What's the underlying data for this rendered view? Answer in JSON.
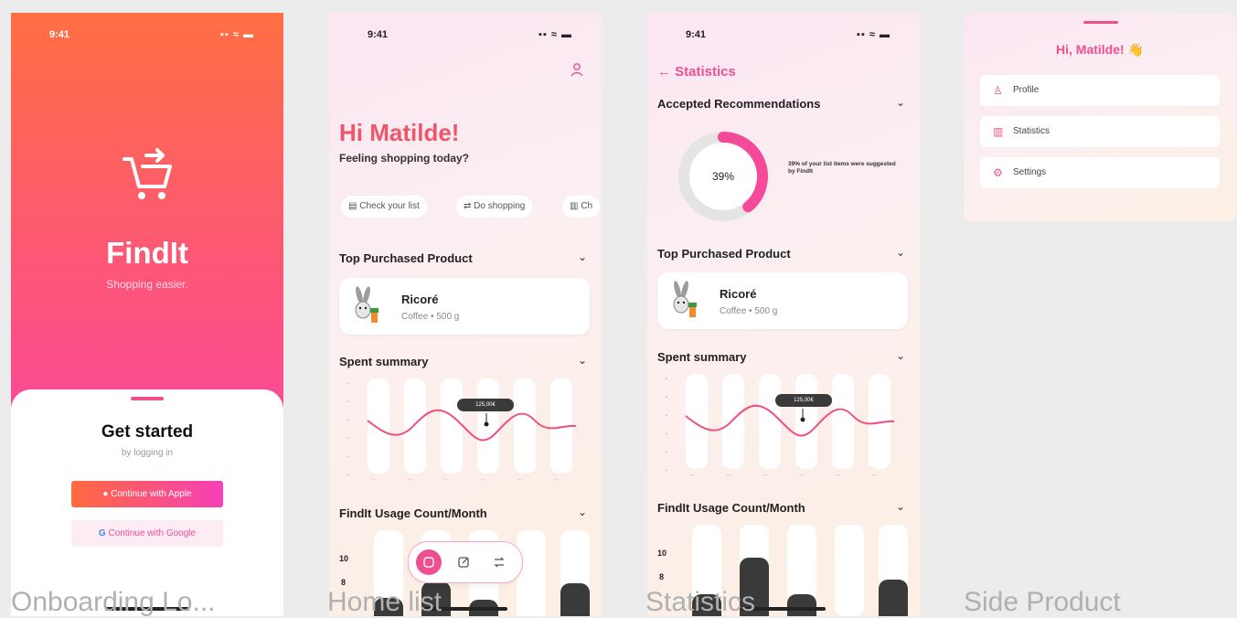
{
  "screens": {
    "onboarding": {
      "status_time": "9:41",
      "status_icons": "▪▪ ≈ ▬",
      "app_name": "FindIt",
      "tagline": "Shopping easier.",
      "sheet_title": "Get started",
      "sheet_subtitle": "by logging in",
      "apple_button": "Continue with Apple",
      "google_button": "Continue with Google",
      "google_g": "G",
      "caption": "Onboarding Lo..."
    },
    "home": {
      "status_time": "9:41",
      "status_icons": "▪▪ ≈ ▬",
      "greeting": "Hi Matilde!",
      "subgreeting": "Feeling shopping today?",
      "chips": [
        "Check your list",
        "Do shopping",
        "Ch"
      ],
      "top_section": "Top Purchased Product",
      "product_name": "Ricoré",
      "product_sub": "Coffee • 500 g",
      "spent_section": "Spent summary",
      "spent_tooltip": "125,00€",
      "usage_section": "FindIt Usage Count/Month",
      "usage_y": [
        "10",
        "8"
      ],
      "caption": "Home list"
    },
    "statistics": {
      "status_time": "9:41",
      "status_icons": "▪▪ ≈ ▬",
      "back_label": "← Statistics",
      "accepted_section": "Accepted Recommendations",
      "donut_value": "39%",
      "donut_fraction": 0.39,
      "donut_text": "39% of your list items were suggested by FindIt",
      "top_section": "Top Purchased Product",
      "product_name": "Ricoré",
      "product_sub": "Coffee • 500 g",
      "spent_section": "Spent summary",
      "spent_tooltip": "125,00€",
      "usage_section": "FindIt Usage Count/Month",
      "usage_y": [
        "10",
        "8"
      ],
      "caption": "Statistics"
    },
    "menu": {
      "greeting": "Hi, Matilde! 👋",
      "items": [
        {
          "label": "Profile",
          "icon": "user-icon"
        },
        {
          "label": "Statistics",
          "icon": "chart-icon"
        },
        {
          "label": "Settings",
          "icon": "gear-icon"
        }
      ],
      "caption": "Side Product"
    }
  },
  "colors": {
    "accent": "#ef4f8f",
    "orange": "#ff6a3d",
    "pink": "#f53fb8"
  }
}
